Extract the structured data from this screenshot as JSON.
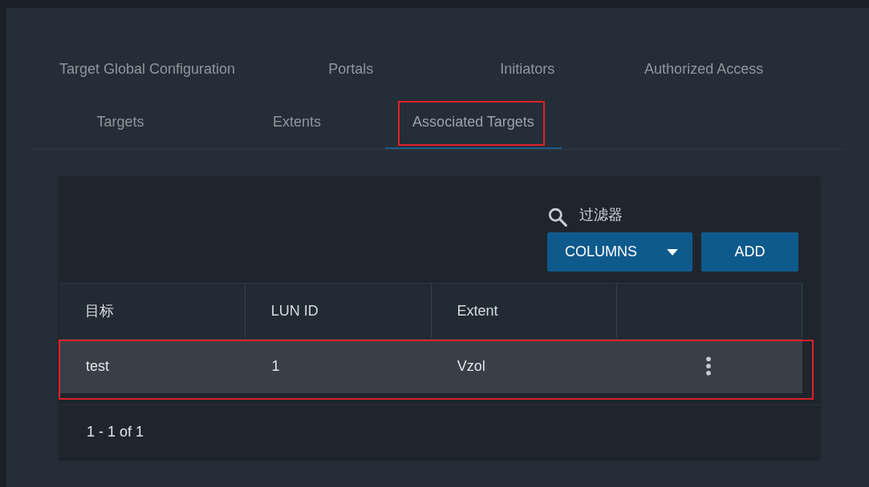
{
  "tabs": [
    {
      "label": "Target Global Configuration",
      "selected": false,
      "highlighted": false
    },
    {
      "label": "Portals",
      "selected": false,
      "highlighted": false
    },
    {
      "label": "Initiators",
      "selected": false,
      "highlighted": false
    },
    {
      "label": "Authorized Access",
      "selected": false,
      "highlighted": false
    },
    {
      "label": "Targets",
      "selected": false,
      "highlighted": false
    },
    {
      "label": "Extents",
      "selected": false,
      "highlighted": false
    },
    {
      "label": "Associated Targets",
      "selected": true,
      "highlighted": true
    }
  ],
  "toolbar": {
    "filter": {
      "placeholder": "过滤器"
    },
    "buttons": [
      {
        "label": "COLUMNS",
        "kind": "dropdown"
      },
      {
        "label": "ADD",
        "kind": "plain"
      }
    ]
  },
  "table": {
    "columns": [
      "目标",
      "LUN ID",
      "Extent"
    ],
    "rows": [
      {
        "cells": [
          "test",
          "1",
          "Vzol"
        ],
        "highlighted": true
      }
    ]
  },
  "pagination": "1 - 1 of 1"
}
